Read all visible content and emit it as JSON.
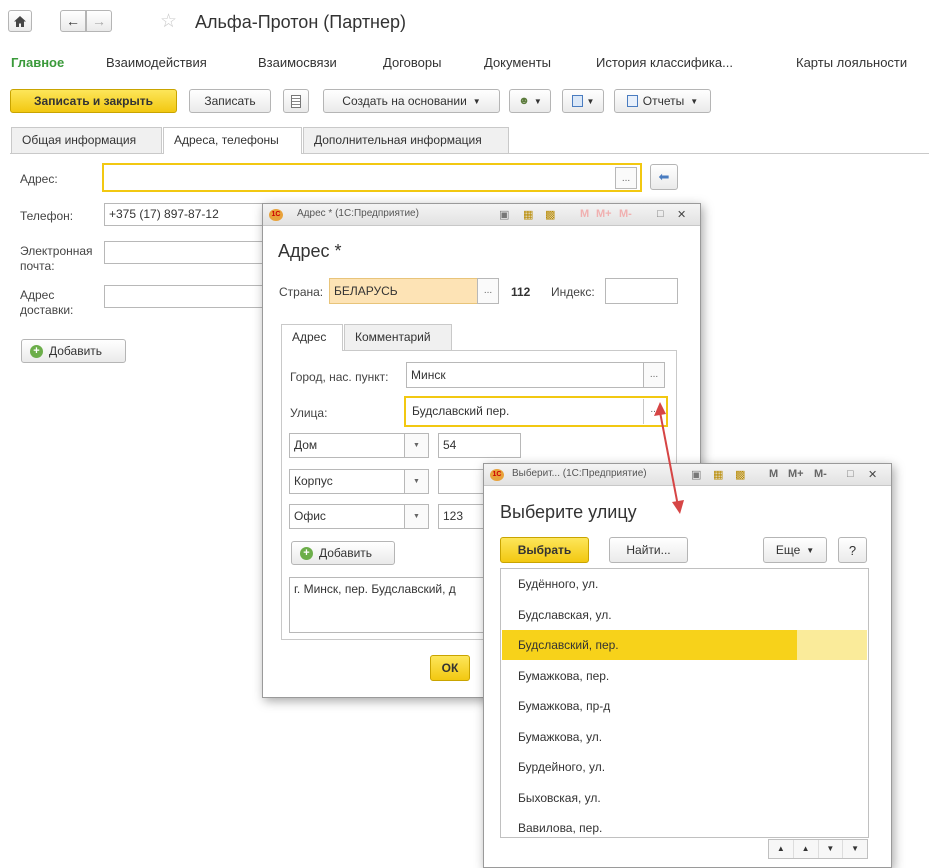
{
  "header": {
    "title": "Альфа-Протон (Партнер)"
  },
  "nav": {
    "items": [
      "Главное",
      "Взаимодействия",
      "Взаимосвязи",
      "Договоры",
      "Документы",
      "История классифика...",
      "Карты лояльности"
    ]
  },
  "toolbar": {
    "save_close": "Записать и закрыть",
    "save": "Записать",
    "create_based": "Создать на основании",
    "reports": "Отчеты"
  },
  "tabs": [
    "Общая информация",
    "Адреса, телефоны",
    "Дополнительная информация"
  ],
  "form": {
    "address_label": "Адрес:",
    "phone_label": "Телефон:",
    "phone_value": "+375 (17) 897-87-12",
    "email_label_1": "Электронная",
    "email_label_2": "почта:",
    "delivery_label_1": "Адрес",
    "delivery_label_2": "доставки:",
    "add_button": "Добавить"
  },
  "address_dialog": {
    "window_caption": "Адрес * (1С:Предприятие)",
    "title": "Адрес *",
    "country_label": "Страна:",
    "country_value": "БЕЛАРУСЬ",
    "country_code": "112",
    "index_label": "Индекс:",
    "index_value": "",
    "tabs": [
      "Адрес",
      "Комментарий"
    ],
    "city_label": "Город, нас. пункт:",
    "city_value": "Минск",
    "street_label": "Улица:",
    "street_value": "Будславский пер.",
    "house_type": "Дом",
    "house_value": "54",
    "corpus_type": "Корпус",
    "corpus_value": "",
    "office_type": "Офис",
    "office_value": "123",
    "add_button": "Добавить",
    "summary": "г. Минск, пер. Будславский, д",
    "ok_button": "ОК"
  },
  "street_dialog": {
    "window_caption": "Выберит... (1С:Предприятие)",
    "title": "Выберите улицу",
    "select_button": "Выбрать",
    "find_button": "Найти...",
    "more_button": "Еще",
    "help_button": "?",
    "streets": [
      "Будённого, ул.",
      "Будславская, ул.",
      "Будславский, пер.",
      "Бумажкова, пер.",
      "Бумажкова, пр-д",
      "Бумажкова, ул.",
      "Бурдейного, ул.",
      "Быховская, ул.",
      "Вавилова, пер."
    ],
    "selected_index": 2
  },
  "colors": {
    "accent_yellow": "#f2c811",
    "nav_active": "#3a9a3a",
    "arrow": "#d64545"
  }
}
